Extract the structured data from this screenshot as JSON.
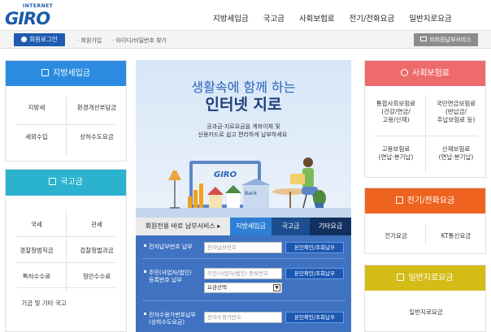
{
  "header": {
    "logo_small": "INTERNET",
    "logo_big": "GIRO",
    "nav": [
      "지방세입금",
      "국고금",
      "사회보험료",
      "전기/전화요금",
      "일반지로요금"
    ]
  },
  "subbar": {
    "login": "회원로그인",
    "signup": "· 회원가입",
    "find": "· 아이디/비밀번호 찾기",
    "nonmember": "비회원납부서비스"
  },
  "left_panel_1": {
    "title": "지방세입금",
    "items": [
      "지방세",
      "환경개선부담금",
      "세외수입",
      "상하수도요금"
    ]
  },
  "left_panel_2": {
    "title": "국고금",
    "items": [
      "국세",
      "관세",
      "경찰청범칙금",
      "검찰청벌과금",
      "특허수수료",
      "형만수수료",
      "기금 및 기타 국고"
    ]
  },
  "banner": {
    "line1": "생활속에 함께 하는",
    "line2": "인터넷 지로",
    "desc1": "공과금·지로요금을 계좌이체 및",
    "desc2": "신용카드로 쉽고 편리하게 납부하세요.",
    "screen_logo": "GIRO",
    "bank_sign": "Bank"
  },
  "tabs": {
    "member": "회원전용 바로 납부서비스",
    "local": "지방세입금",
    "national": "국고금",
    "other": "기타요금"
  },
  "form": {
    "row1_label": "전자납부번호 납부",
    "row1_placeholder": "전자납부번호",
    "row1_btn": "본인확인/조회납부",
    "row2_label_1": "주민(사업자/법인)",
    "row2_label_2": "등록번호 납부",
    "row2_placeholder": "주민(사업자/법인) 등록번호",
    "row2_btn": "본인확인/조회납부",
    "row2_select": "요금선택",
    "row3_label_1": "전자수용가번호납부",
    "row3_label_2": "(상하수도요금)",
    "row3_placeholder": "전자수용가번호",
    "row3_btn": "본인확인/조회납부"
  },
  "right_panel_1": {
    "title": "사회보험료",
    "items": [
      "통합사회보험료\n(건강/연금/\n고용/산재)",
      "국민연금보험료\n(반납금/\n추납보험료 등)",
      "고용보험료\n(연납·분기납)",
      "산재보험료\n(연납·분기납)"
    ]
  },
  "right_panel_2": {
    "title": "전기/전화요금",
    "items": [
      "전기요금",
      "KT통신요금"
    ]
  },
  "right_panel_3": {
    "title": "일반지로요금",
    "items": [
      "일반지로요금"
    ]
  },
  "colors": {
    "brand_blue": "#1a5aa8",
    "local_header": "#2b8be0",
    "national_header": "#2bb2cf",
    "insurance_header": "#ee6b6b",
    "utility_header": "#ee6320",
    "giro_header": "#d4bb16",
    "tab_active": "#2f7fd5",
    "form_bg": "#3f73c2"
  }
}
